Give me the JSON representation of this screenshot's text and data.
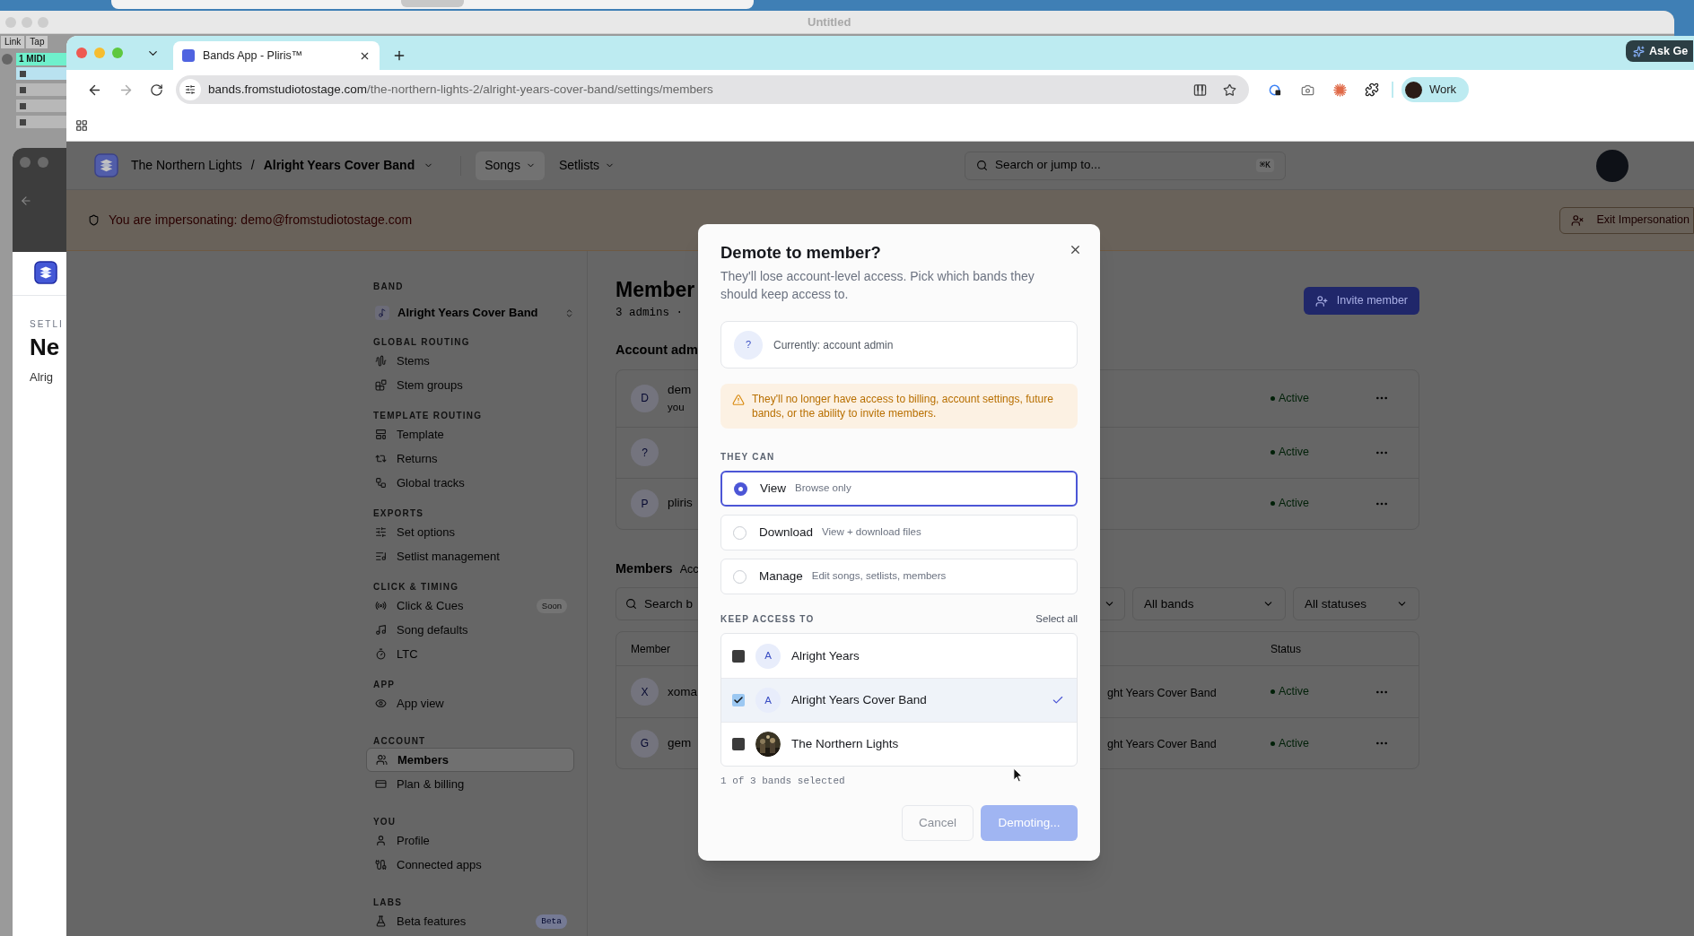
{
  "desktop": {
    "background_window_title": "Untitled",
    "daw_buttons": [
      "Link",
      "Tap"
    ],
    "daw_track": "1 MIDI",
    "behind_window": {
      "label": "SETLI",
      "title": "Ne",
      "subtitle": "Alrig"
    }
  },
  "browser": {
    "tab": {
      "title": "Bands App - Pliris™"
    },
    "url": {
      "host": "bands.fromstudiotostage.com",
      "path": "/the-northern-lights-2/alright-years-cover-band/settings/members"
    },
    "ask_button": "Ask Ge",
    "profile": "Work"
  },
  "header": {
    "breadcrumb": [
      "The Northern Lights",
      "Alright Years Cover Band"
    ],
    "breadcrumb_separator": "/",
    "nav": [
      {
        "label": "Songs",
        "selected": true
      },
      {
        "label": "Setlists",
        "selected": false
      }
    ],
    "search": {
      "placeholder": "Search or jump to...",
      "shortcut": "⌘K"
    }
  },
  "impersonation": {
    "message": "You are impersonating: demo@fromstudiotostage.com",
    "button": "Exit Impersonation"
  },
  "sidebar": {
    "band_label": "BAND",
    "band": "Alright Years Cover Band",
    "sections": [
      {
        "title": "GLOBAL ROUTING",
        "items": [
          {
            "label": "Stems",
            "selected": false
          },
          {
            "label": "Stem groups",
            "selected": false
          }
        ]
      },
      {
        "title": "TEMPLATE ROUTING",
        "items": [
          {
            "label": "Template",
            "selected": false
          },
          {
            "label": "Returns",
            "selected": false
          },
          {
            "label": "Global tracks",
            "selected": false
          }
        ]
      },
      {
        "title": "EXPORTS",
        "items": [
          {
            "label": "Set options",
            "selected": false
          },
          {
            "label": "Setlist management",
            "selected": false
          }
        ]
      },
      {
        "title": "CLICK & TIMING",
        "items": [
          {
            "label": "Click & Cues",
            "selected": false,
            "badge": "Soon"
          },
          {
            "label": "Song defaults",
            "selected": false
          },
          {
            "label": "LTC",
            "selected": false
          }
        ]
      },
      {
        "title": "APP",
        "items": [
          {
            "label": "App view",
            "selected": false
          }
        ]
      },
      {
        "title": "ACCOUNT",
        "items": [
          {
            "label": "Members",
            "selected": true
          },
          {
            "label": "Plan & billing",
            "selected": false
          }
        ]
      },
      {
        "title": "YOU",
        "items": [
          {
            "label": "Profile",
            "selected": false
          },
          {
            "label": "Connected apps",
            "selected": false
          }
        ]
      },
      {
        "title": "LABS",
        "items": [
          {
            "label": "Beta features",
            "selected": false,
            "badge": "Beta"
          }
        ]
      }
    ]
  },
  "main": {
    "title": "Member",
    "subtitle": "3 admins ·",
    "invite_button": "Invite member",
    "admins_title": "Account adm",
    "admins": [
      {
        "initial": "D",
        "name": "dem",
        "note": "you",
        "status": "Active"
      },
      {
        "initial": "?",
        "status": "Active"
      },
      {
        "initial": "P",
        "name": "pliris",
        "status": "Active"
      }
    ],
    "members_title": "Members",
    "members_subtitle": "Acc",
    "search_placeholder": "Search b",
    "filters": [
      "All bands",
      "All statuses"
    ],
    "columns": [
      "Member",
      "Status"
    ],
    "rows": [
      {
        "initial": "X",
        "name": "xoma",
        "band": "ght Years Cover Band",
        "status": "Active"
      },
      {
        "initial": "G",
        "name": "gem",
        "band": "ght Years Cover Band",
        "status": "Active"
      }
    ]
  },
  "modal": {
    "title": "Demote to member?",
    "description": "They'll lose account-level access. Pick which bands they should keep access to.",
    "current": {
      "initial": "?",
      "text": "Currently: account admin"
    },
    "warning": "They'll no longer have access to billing, account settings, future bands, or the ability to invite members.",
    "roles_label": "THEY CAN",
    "roles": [
      {
        "name": "View",
        "description": "Browse only",
        "selected": true
      },
      {
        "name": "Download",
        "description": "View + download files",
        "selected": false
      },
      {
        "name": "Manage",
        "description": "Edit songs, setlists, members",
        "selected": false
      }
    ],
    "bands_label": "KEEP ACCESS TO",
    "select_all": "Select all",
    "bands": [
      {
        "avatar": {
          "kind": "initial",
          "text": "A"
        },
        "name": "Alright Years",
        "checked": false
      },
      {
        "avatar": {
          "kind": "initial",
          "text": "A"
        },
        "name": "Alright Years Cover Band",
        "checked": true
      },
      {
        "name": "The Northern Lights",
        "checked": false
      }
    ],
    "selection_summary": "1 of 3 bands selected",
    "cancel": "Cancel",
    "confirm": {
      "label": "Demoting...",
      "disabled": true
    }
  }
}
